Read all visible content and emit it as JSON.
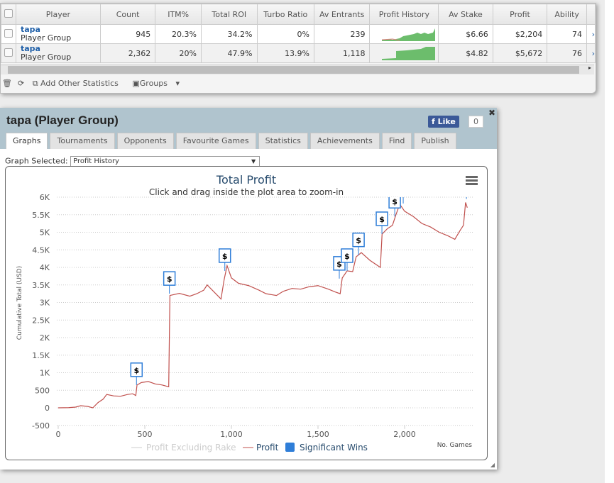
{
  "table": {
    "headers": [
      "Player",
      "Count",
      "ITM%",
      "Total ROI",
      "Turbo Ratio",
      "Av Entrants",
      "Profit History",
      "Av Stake",
      "Profit",
      "Ability"
    ],
    "rows": [
      {
        "name": "tapa",
        "sub": "Player Group",
        "count": "945",
        "itm": "20.3%",
        "roi": "34.2%",
        "turbo": "0%",
        "entrants": "239",
        "stake": "$6.66",
        "profit": "$2,204",
        "ability": "74"
      },
      {
        "name": "tapa",
        "sub": "Player Group",
        "count": "2,362",
        "itm": "20%",
        "roi": "47.9%",
        "turbo": "13.9%",
        "entrants": "1,118",
        "stake": "$4.82",
        "profit": "$5,672",
        "ability": "76"
      }
    ]
  },
  "toolbar": {
    "add_stats": "Add Other Statistics",
    "groups": "Groups"
  },
  "dialog": {
    "title": "tapa (Player Group)",
    "like": "Like",
    "like_count": "0",
    "tabs": [
      "Graphs",
      "Tournaments",
      "Opponents",
      "Favourite Games",
      "Statistics",
      "Achievements",
      "Find",
      "Publish"
    ],
    "graph_label": "Graph Selected:",
    "graph_value": "Profit History"
  },
  "chart_data": {
    "type": "line",
    "title": "Total Profit",
    "subtitle": "Click and drag inside the plot area to zoom-in",
    "ylabel": "Cumulative Total (USD)",
    "xlabel": "No. Games",
    "xlim": [
      0,
      2400
    ],
    "ylim": [
      -500,
      6000
    ],
    "xticks": [
      "0",
      "500",
      "1,000",
      "1,500",
      "2,000"
    ],
    "xtick_values": [
      0,
      500,
      1000,
      1500,
      2000
    ],
    "yticks": [
      "6K",
      "5.5K",
      "5K",
      "4.5K",
      "4K",
      "3.5K",
      "3K",
      "2.5K",
      "2K",
      "1.5K",
      "1K",
      "500",
      "0",
      "-500"
    ],
    "ytick_values": [
      6000,
      5500,
      5000,
      4500,
      4000,
      3500,
      3000,
      2500,
      2000,
      1500,
      1000,
      500,
      0,
      -500
    ],
    "legend": [
      "Profit Excluding Rake",
      "Profit",
      "Significant Wins"
    ],
    "colors": {
      "profit": "#c0504d",
      "wins": "#2f7ed8",
      "excl": "#cccccc"
    },
    "series": [
      {
        "name": "Profit",
        "points": [
          [
            0,
            0
          ],
          [
            60,
            5
          ],
          [
            100,
            20
          ],
          [
            130,
            60
          ],
          [
            170,
            40
          ],
          [
            200,
            0
          ],
          [
            230,
            150
          ],
          [
            260,
            250
          ],
          [
            280,
            380
          ],
          [
            320,
            340
          ],
          [
            360,
            330
          ],
          [
            400,
            380
          ],
          [
            430,
            400
          ],
          [
            448,
            350
          ],
          [
            455,
            650
          ],
          [
            480,
            720
          ],
          [
            520,
            750
          ],
          [
            560,
            680
          ],
          [
            600,
            650
          ],
          [
            638,
            600
          ],
          [
            645,
            3200
          ],
          [
            700,
            3260
          ],
          [
            760,
            3180
          ],
          [
            800,
            3250
          ],
          [
            840,
            3350
          ],
          [
            860,
            3500
          ],
          [
            900,
            3300
          ],
          [
            940,
            3100
          ],
          [
            958,
            3650
          ],
          [
            975,
            4050
          ],
          [
            1000,
            3700
          ],
          [
            1040,
            3550
          ],
          [
            1100,
            3480
          ],
          [
            1160,
            3350
          ],
          [
            1200,
            3250
          ],
          [
            1260,
            3200
          ],
          [
            1300,
            3320
          ],
          [
            1350,
            3400
          ],
          [
            1400,
            3380
          ],
          [
            1450,
            3450
          ],
          [
            1500,
            3480
          ],
          [
            1560,
            3380
          ],
          [
            1600,
            3300
          ],
          [
            1628,
            3250
          ],
          [
            1640,
            3700
          ],
          [
            1668,
            3900
          ],
          [
            1700,
            3880
          ],
          [
            1720,
            4300
          ],
          [
            1750,
            4420
          ],
          [
            1800,
            4200
          ],
          [
            1860,
            4000
          ],
          [
            1870,
            4950
          ],
          [
            1900,
            5100
          ],
          [
            1930,
            5200
          ],
          [
            1950,
            5500
          ],
          [
            1972,
            5800
          ],
          [
            2000,
            5600
          ],
          [
            2050,
            5450
          ],
          [
            2100,
            5250
          ],
          [
            2150,
            5150
          ],
          [
            2200,
            5000
          ],
          [
            2250,
            4900
          ],
          [
            2290,
            4800
          ],
          [
            2320,
            5050
          ],
          [
            2340,
            5200
          ],
          [
            2352,
            5850
          ],
          [
            2362,
            5700
          ]
        ]
      }
    ],
    "significant_wins": [
      [
        452,
        650
      ],
      [
        642,
        3250
      ],
      [
        962,
        3900
      ],
      [
        1623,
        3680
      ],
      [
        1668,
        3900
      ],
      [
        1734,
        4350
      ],
      [
        1869,
        4950
      ],
      [
        1943,
        5450
      ],
      [
        1992,
        5820
      ],
      [
        2357,
        5950
      ]
    ]
  }
}
